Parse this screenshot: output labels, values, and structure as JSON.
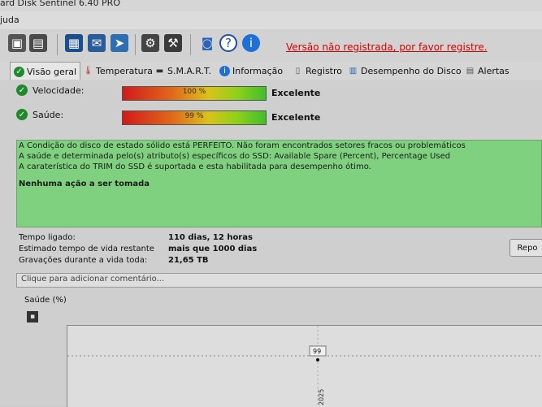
{
  "window": {
    "title": "ard Disk Sentinel 6.40 PRO"
  },
  "menu": {
    "item": "juda"
  },
  "toolbar": {
    "icons": [
      "disk-icon",
      "disk-icon",
      "disk-icon",
      "report-icon",
      "mail-icon",
      "send-icon",
      "gear-icon",
      "tools-icon",
      "camera-icon",
      "help-icon",
      "info-icon"
    ],
    "unregistered": "Versão não registrada, por favor registre."
  },
  "tabs": [
    {
      "label": "Visão geral",
      "icon": "check-icon"
    },
    {
      "label": "Temperatura",
      "icon": "thermometer-icon"
    },
    {
      "label": "S.M.A.R.T.",
      "icon": "dash-icon"
    },
    {
      "label": "Informação",
      "icon": "info-icon"
    },
    {
      "label": "Registro",
      "icon": "document-icon"
    },
    {
      "label": "Desempenho do Disco",
      "icon": "chart-icon"
    },
    {
      "label": "Alertas",
      "icon": "alert-icon"
    }
  ],
  "metrics": [
    {
      "label": "Velocidade:",
      "value_text": "100 %",
      "level": 100,
      "rating": "Excelente"
    },
    {
      "label": "Saúde:",
      "value_text": "99 %",
      "level": 99,
      "rating": "Excelente"
    }
  ],
  "status": {
    "lines": [
      "A Condição do disco de estado sólido está PERFEITO. Não foram encontrados setores fracos ou problemáticos",
      "A saúde e determinada pelo(s) atributo(s) específicos do SSD: Available Spare (Percent), Percentage Used",
      "A caraterística do TRIM do SSD é suportada e esta habilitada para desempenho ótimo."
    ],
    "action": "Nenhuma ação a ser tomada"
  },
  "info": [
    {
      "label": "Tempo ligado:",
      "value": "110 dias, 12 horas"
    },
    {
      "label": "Estimado tempo de vida restante",
      "value": "mais que 1000 dias"
    },
    {
      "label": "Gravações durante a vida toda:",
      "value": "21,65 TB"
    }
  ],
  "report_button": "Repo",
  "comment": {
    "placeholder": "Clique para adicionar  comentário..."
  },
  "chart": {
    "label": "Saúde (%)"
  },
  "chart_data": {
    "type": "line",
    "title": "Saúde (%)",
    "y_tick": "99",
    "points": [
      {
        "y": 99,
        "label": "99"
      }
    ],
    "x_tick": "2025"
  }
}
